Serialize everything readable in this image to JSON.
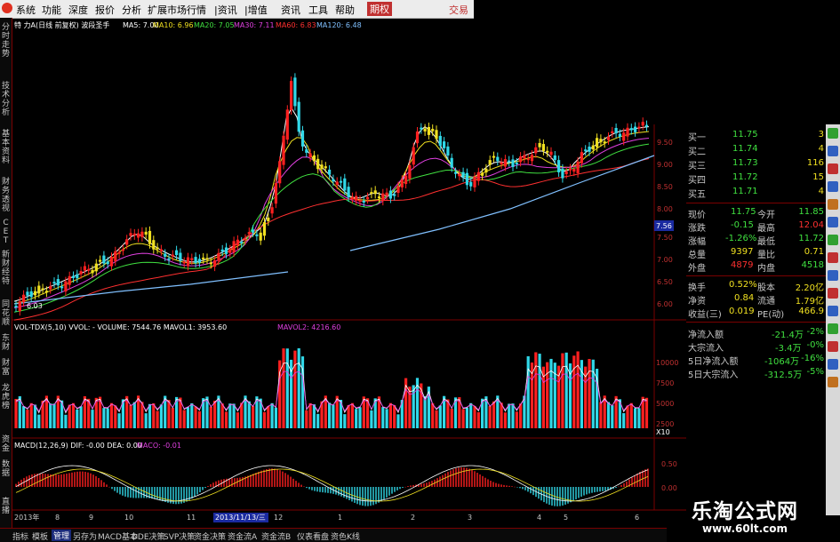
{
  "menu": {
    "items": [
      "系统",
      "功能",
      "深度",
      "报价",
      "分析",
      "扩展市场行情",
      "|资讯",
      "|增值",
      "资讯",
      "工具",
      "帮助",
      "期权"
    ],
    "trade": "交易"
  },
  "leftbar": [
    "分时走势",
    "技术分析",
    "基本资料",
    "财务透视",
    "CET",
    "新财经特",
    "同花顺",
    "东财",
    "财富",
    "龙虎榜",
    "资金",
    "数据",
    "直播"
  ],
  "header": {
    "stock": "特 力A(日线 前复权) 波段圣手",
    "ma5": "MA5: 7.00",
    "ma10": "MA10: 6.96",
    "ma20": "MA20: 7.05",
    "ma30": "MA30: 7.11",
    "ma60": "MA60: 6.83",
    "ma120": "MA120: 6.48"
  },
  "price_chart": {
    "low_label": "6.03",
    "ylabels": [
      "9.50",
      "9.00",
      "8.50",
      "8.00",
      "7.56",
      "7.50",
      "7.00",
      "6.50",
      "6.00"
    ],
    "current_tag": "7.56",
    "ylim": [
      5.95,
      9.8
    ]
  },
  "volume_chart": {
    "header": "VOL-TDX(5,10)  VVOL: -  VOLUME: 7544.76  MAVOL1: 3953.60",
    "mavol2": "MAVOL2: 4216.60",
    "ylabels": [
      "10000",
      "7500",
      "5000",
      "2500"
    ],
    "unit": "X10"
  },
  "macd_chart": {
    "header": "MACD(12,26,9)  DIF: -0.00  DEA: 0.00",
    "maco": "MACO: -0.01",
    "ylabels": [
      "0.50",
      "0.00"
    ]
  },
  "date_axis": {
    "labels": [
      "2013年",
      "8",
      "9",
      "10",
      "11",
      "2013/11/13/三",
      "12",
      "1",
      "2",
      "3",
      "4",
      "5",
      "6"
    ]
  },
  "quotes": {
    "bids": [
      {
        "label": "买一",
        "price": "11.75",
        "vol": "3"
      },
      {
        "label": "买二",
        "price": "11.74",
        "vol": "4"
      },
      {
        "label": "买三",
        "price": "11.73",
        "vol": "116"
      },
      {
        "label": "买四",
        "price": "11.72",
        "vol": "15"
      },
      {
        "label": "买五",
        "price": "11.71",
        "vol": "4"
      }
    ],
    "stats": [
      {
        "l1": "现价",
        "v1": "11.75",
        "l2": "今开",
        "v2": "11.85"
      },
      {
        "l1": "涨跌",
        "v1": "-0.15",
        "l2": "最高",
        "v2": "12.04"
      },
      {
        "l1": "涨幅",
        "v1": "-1.26%",
        "l2": "最低",
        "v2": "11.72"
      },
      {
        "l1": "总量",
        "v1": "9397",
        "l2": "量比",
        "v2": "0.71"
      },
      {
        "l1": "外盘",
        "v1": "4879",
        "l2": "内盘",
        "v2": "4518"
      },
      {
        "l1": "换手",
        "v1": "0.52%",
        "l2": "股本",
        "v2": "2.20亿"
      },
      {
        "l1": "净资",
        "v1": "0.84",
        "l2": "流通",
        "v2": "1.79亿"
      },
      {
        "l1": "收益(三)",
        "v1": "0.019",
        "l2": "PE(动)",
        "v2": "466.9"
      }
    ],
    "flows": [
      {
        "label": "净流入额",
        "v1": "-21.4万",
        "v2": "-2%"
      },
      {
        "label": "大宗流入",
        "v1": "-3.4万",
        "v2": "-0%"
      },
      {
        "label": "5日净流入额",
        "v1": "-1064万",
        "v2": "-16%"
      },
      {
        "label": "5日大宗流入",
        "v1": "-312.5万",
        "v2": "-5%"
      }
    ]
  },
  "statusbar": {
    "tabs": [
      "指标",
      "模板",
      "管理",
      "另存为",
      "MACD基本",
      "DDE决策",
      "SVP决策",
      "资金决策",
      "资金流A",
      "资金流B",
      "仪表看盘",
      "资色K线"
    ]
  },
  "watermark": {
    "line1": "乐淘公式网",
    "line2": "www.60lt.com"
  },
  "colors": {
    "up": "#ff2020",
    "down": "#30d8e8",
    "highlight": "#f0e020",
    "ma5": "#ffffff",
    "ma10": "#f0e020",
    "ma20": "#e040e0",
    "ma30": "#40e040",
    "ma60": "#ff3030",
    "ma120": "#80c0ff"
  }
}
